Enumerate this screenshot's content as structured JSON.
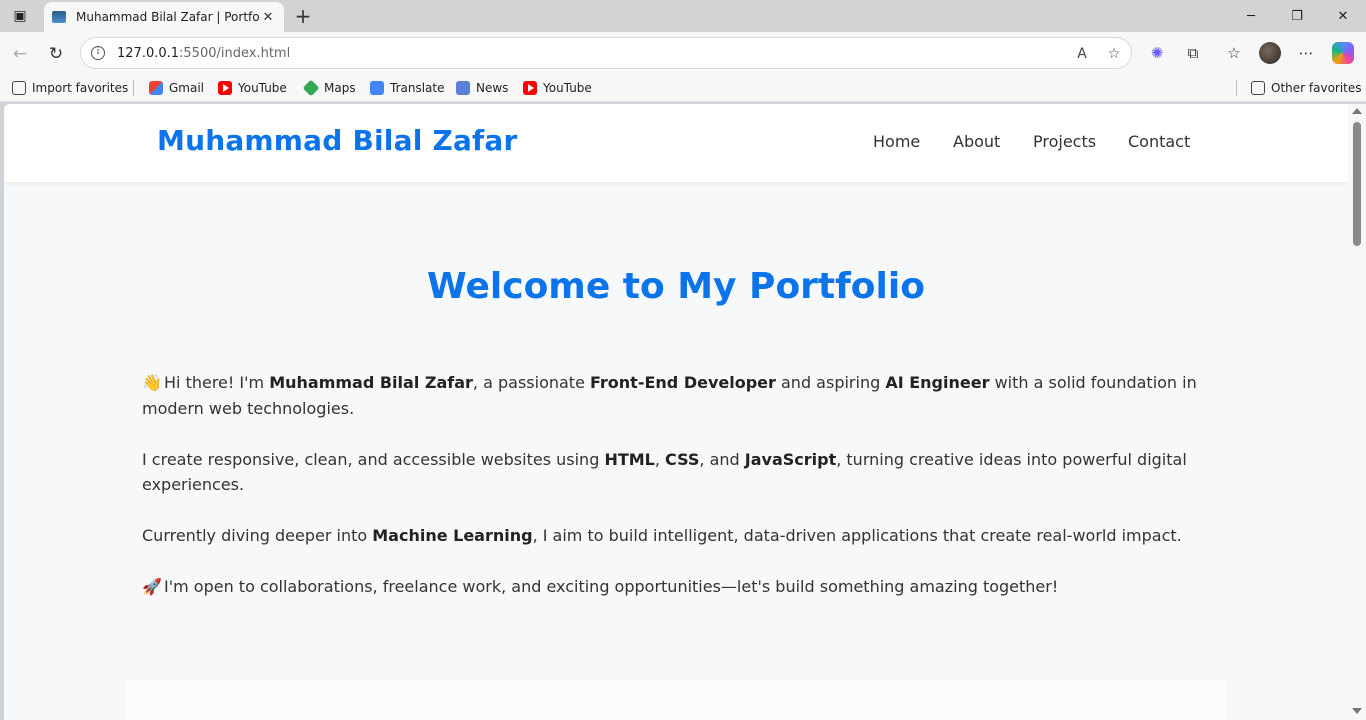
{
  "browser": {
    "tab_title": "Muhammad Bilal Zafar | Portfolio",
    "url_host": "127.0.0.1",
    "url_rest": ":5500/index.html",
    "favorites": [
      {
        "label": "Import favorites",
        "icon": "import-icon"
      },
      {
        "label": "Gmail",
        "icon": "gmail-icon"
      },
      {
        "label": "YouTube",
        "icon": "youtube-icon"
      },
      {
        "label": "Maps",
        "icon": "maps-icon"
      },
      {
        "label": "Translate",
        "icon": "translate-icon"
      },
      {
        "label": "News",
        "icon": "news-icon"
      },
      {
        "label": "YouTube",
        "icon": "youtube-icon"
      }
    ],
    "other_favorites": "Other favorites"
  },
  "site": {
    "name": "Muhammad Bilal Zafar",
    "nav": [
      "Home",
      "About",
      "Projects",
      "Contact"
    ],
    "hero_title": "Welcome to My Portfolio",
    "about": {
      "p1_emoji": "👋",
      "p1_a": "Hi there! I'm ",
      "p1_b": "Muhammad Bilal Zafar",
      "p1_c": ", a passionate ",
      "p1_d": "Front-End Developer",
      "p1_e": " and aspiring ",
      "p1_f": "AI Engineer",
      "p1_g": " with a solid foundation in modern web technologies.",
      "p2_a": "I create responsive, clean, and accessible websites using ",
      "p2_b": "HTML",
      "p2_c": ", ",
      "p2_d": "CSS",
      "p2_e": ", and ",
      "p2_f": "JavaScript",
      "p2_g": ", turning creative ideas into powerful digital experiences.",
      "p3_a": "Currently diving deeper into ",
      "p3_b": "Machine Learning",
      "p3_c": ", I aim to build intelligent, data-driven applications that create real-world impact.",
      "p4_emoji": "🚀",
      "p4_a": "I'm open to collaborations, freelance work, and exciting opportunities—let's build something amazing together!"
    }
  },
  "colors": {
    "brand_blue": "#0b74ea",
    "page_bg": "#f6f8fa"
  }
}
